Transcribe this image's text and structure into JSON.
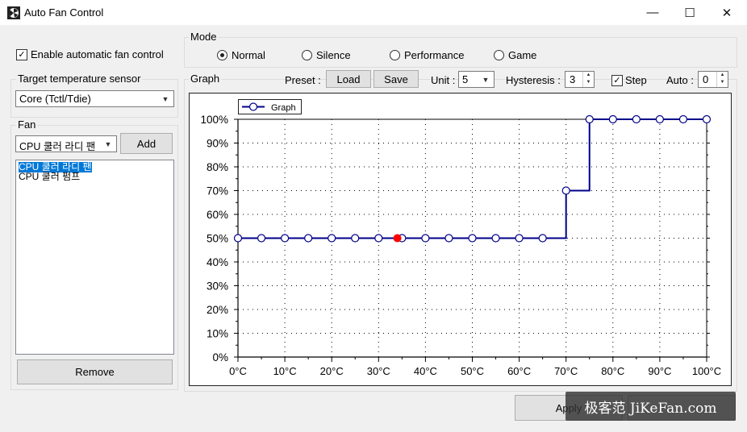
{
  "window": {
    "title": "Auto Fan Control",
    "minimize": "—",
    "maximize": "☐",
    "close": "✕"
  },
  "left": {
    "enable_label": "Enable automatic fan control",
    "enable_checked": true,
    "sensor_label": "Target temperature sensor",
    "sensor_value": "Core (Tctl/Tdie)",
    "fan_label": "Fan",
    "fan_value": "CPU 쿨러 라디 팬",
    "add_label": "Add",
    "fan_list": [
      "CPU 쿨러 라디 팬",
      "CPU 쿨러 펌프"
    ],
    "remove_label": "Remove"
  },
  "mode": {
    "label": "Mode",
    "options": [
      "Normal",
      "Silence",
      "Performance",
      "Game"
    ],
    "selected": "Normal"
  },
  "graph_controls": {
    "label": "Graph",
    "preset_label": "Preset :",
    "load_label": "Load",
    "save_label": "Save",
    "unit_label": "Unit :",
    "unit_value": "5",
    "hysteresis_label": "Hysteresis :",
    "hysteresis_value": "3",
    "step_label": "Step",
    "step_checked": true,
    "auto_label": "Auto :",
    "auto_value": "0"
  },
  "footer": {
    "apply_label": "Apply"
  },
  "watermark": "极客范 JiKeFan.com",
  "colors": {
    "line": "#00008b",
    "current_point": "#ff0000",
    "selection": "#0078d7"
  },
  "chart_data": {
    "type": "line",
    "legend": [
      "Graph"
    ],
    "series": [
      {
        "name": "Graph",
        "x": [
          0,
          5,
          10,
          15,
          20,
          25,
          30,
          35,
          40,
          45,
          50,
          55,
          60,
          65,
          70,
          75,
          80,
          85,
          90,
          95,
          100
        ],
        "y": [
          50,
          50,
          50,
          50,
          50,
          50,
          50,
          50,
          50,
          50,
          50,
          50,
          50,
          50,
          70,
          100,
          100,
          100,
          100,
          100,
          100
        ]
      }
    ],
    "current_point": {
      "x": 34,
      "y": 50
    },
    "step": true,
    "xlim": [
      0,
      100
    ],
    "ylim": [
      0,
      100
    ],
    "x_ticks": [
      "0°C",
      "10°C",
      "20°C",
      "30°C",
      "40°C",
      "50°C",
      "60°C",
      "70°C",
      "80°C",
      "90°C",
      "100°C"
    ],
    "y_ticks": [
      "0%",
      "10%",
      "20%",
      "30%",
      "40%",
      "50%",
      "60%",
      "70%",
      "80%",
      "90%",
      "100%"
    ],
    "grid": "dotted"
  }
}
